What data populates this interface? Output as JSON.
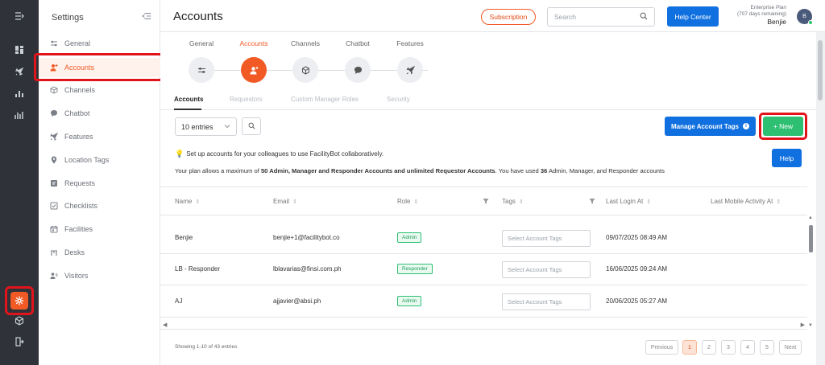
{
  "sidebar": {
    "title": "Settings",
    "items": [
      {
        "label": "General",
        "icon": "sliders-icon"
      },
      {
        "label": "Accounts",
        "icon": "user-plus-icon"
      },
      {
        "label": "Channels",
        "icon": "cube-icon"
      },
      {
        "label": "Chatbot",
        "icon": "chat-icon"
      },
      {
        "label": "Features",
        "icon": "rocket-icon"
      },
      {
        "label": "Location Tags",
        "icon": "pin-icon"
      },
      {
        "label": "Requests",
        "icon": "ticket-icon"
      },
      {
        "label": "Checklists",
        "icon": "checklist-icon"
      },
      {
        "label": "Facilities",
        "icon": "calendar-icon"
      },
      {
        "label": "Desks",
        "icon": "desk-icon"
      },
      {
        "label": "Visitors",
        "icon": "visitor-icon"
      }
    ],
    "selected": "Accounts"
  },
  "header": {
    "title": "Accounts",
    "subscription_label": "Subscription",
    "search_placeholder": "Search",
    "help_center_label": "Help Center",
    "plan_name": "Enterprise Plan",
    "plan_days": "(707 days remaining)",
    "user_name": "Benjie",
    "avatar_initial": "B"
  },
  "stepper": {
    "steps": [
      {
        "label": "General",
        "icon": "sliders-icon"
      },
      {
        "label": "Accounts",
        "icon": "user-plus-icon"
      },
      {
        "label": "Channels",
        "icon": "cube-icon"
      },
      {
        "label": "Chatbot",
        "icon": "chat-icon"
      },
      {
        "label": "Features",
        "icon": "rocket-icon"
      }
    ],
    "active": "Accounts"
  },
  "subtabs": [
    "Accounts",
    "Requestors",
    "Custom Manager Roles",
    "Security"
  ],
  "toolbar": {
    "entries_value": "10 entries",
    "manage_tags_label": "Manage Account Tags",
    "new_label": "+ New",
    "help_label": "Help"
  },
  "notes": {
    "line1": "Set up accounts for your colleagues to use FacilityBot collaboratively.",
    "line2_prefix": "Your plan allows a maximum of ",
    "line2_bold1": "50 Admin, Manager and Responder Accounts and unlimited Requestor Accounts",
    "line2_mid": ". You have used ",
    "line2_bold2": "36",
    "line2_suffix": " Admin, Manager, and Responder accounts"
  },
  "table": {
    "columns": [
      "Name",
      "Email",
      "Role",
      "Tags",
      "Last Login At",
      "Last Mobile Activity At"
    ],
    "tag_placeholder": "Select Account Tags",
    "rows": [
      {
        "name": "Benjie",
        "email": "benjie+1@facilitybot.co",
        "role": "Admin",
        "last_login": "09/07/2025 08:49 AM"
      },
      {
        "name": "LB - Responder",
        "email": "lblavarias@finsi.com.ph",
        "role": "Responder",
        "last_login": "16/06/2025 09:24 AM"
      },
      {
        "name": "AJ",
        "email": "ajjavier@absi.ph",
        "role": "Admin",
        "last_login": "20/06/2025 05:27 AM"
      }
    ]
  },
  "footer": {
    "showing": "Showing 1-10 of 43 entries",
    "pages": [
      "Previous",
      "1",
      "2",
      "3",
      "4",
      "5",
      "Next"
    ],
    "current_page": "1"
  },
  "colors": {
    "accent": "#f15a24",
    "primary": "#1070e0",
    "success": "#2dbf72",
    "highlight": "#e1141b"
  }
}
